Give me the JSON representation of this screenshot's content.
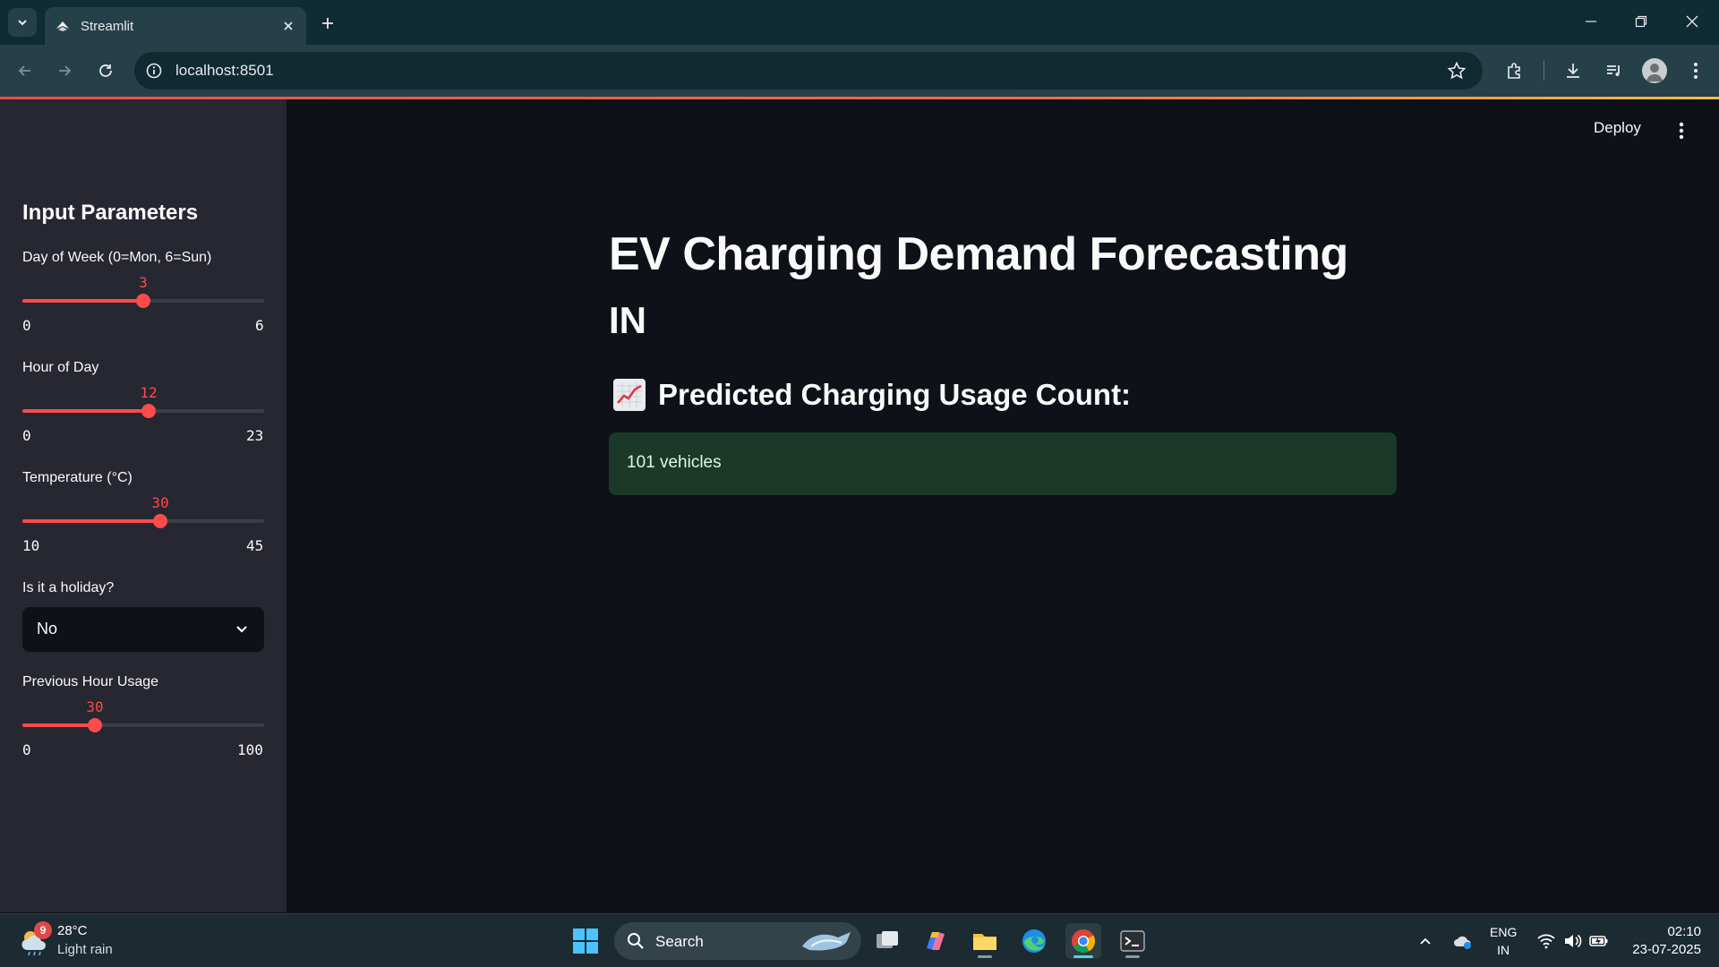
{
  "browser": {
    "tab_title": "Streamlit",
    "url": "localhost:8501"
  },
  "header": {
    "deploy_label": "Deploy"
  },
  "sidebar": {
    "header": "Input Parameters",
    "day_of_week": {
      "label": "Day of Week (0=Mon, 6=Sun)",
      "value": "3",
      "min": "0",
      "max": "6",
      "fraction": 0.5
    },
    "hour_of_day": {
      "label": "Hour of Day",
      "value": "12",
      "min": "0",
      "max": "23",
      "fraction": 0.522
    },
    "temperature": {
      "label": "Temperature (°C)",
      "value": "30",
      "min": "10",
      "max": "45",
      "fraction": 0.571
    },
    "holiday": {
      "label": "Is it a holiday?",
      "value": "No"
    },
    "previous_usage": {
      "label": "Previous Hour Usage",
      "value": "30",
      "min": "0",
      "max": "100",
      "fraction": 0.3
    }
  },
  "main": {
    "title": "EV Charging Demand Forecasting",
    "subtitle": "IN",
    "prediction_header": "Predicted Charging Usage Count:",
    "prediction_icon": "chart-increasing-icon",
    "result_text": "101 vehicles",
    "result_bg": "#1c3829"
  },
  "taskbar": {
    "weather_badge": "9",
    "weather_temp": "28°C",
    "weather_desc": "Light rain",
    "search_label": "Search",
    "lang_1": "ENG",
    "lang_2": "IN",
    "time": "02:10",
    "date": "23-07-2025"
  },
  "colors": {
    "accent": "#ff4b4b",
    "sidebar_bg": "#262730",
    "main_bg": "#0e1117"
  }
}
